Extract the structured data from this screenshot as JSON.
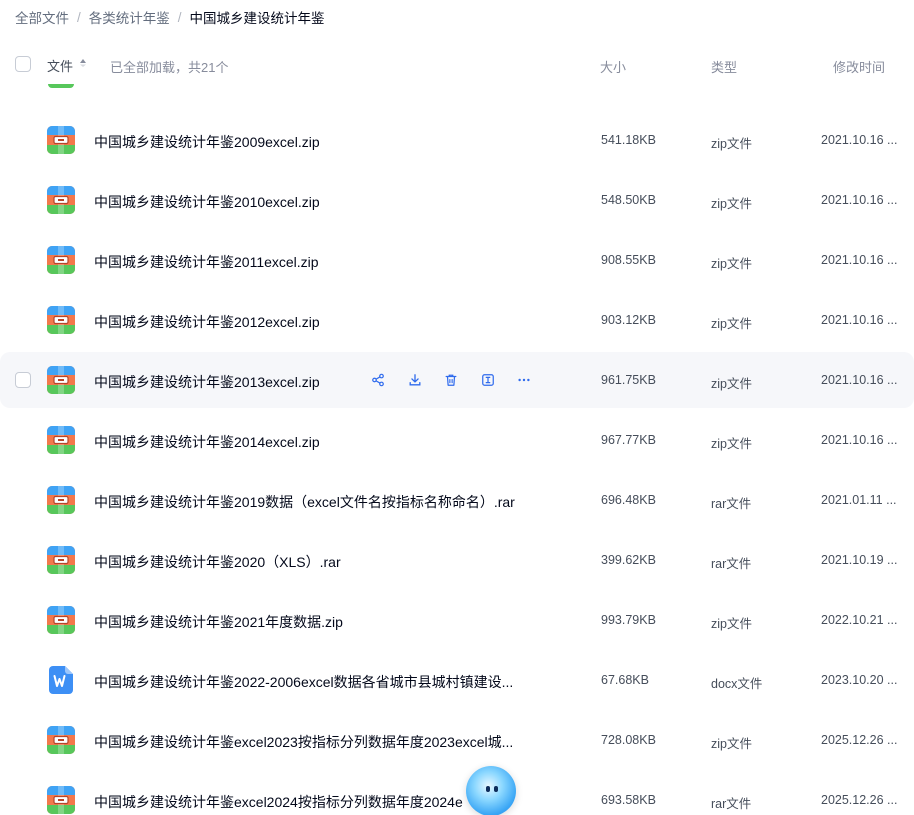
{
  "breadcrumb": {
    "items": [
      "全部文件",
      "各类统计年鉴"
    ],
    "current": "中国城乡建设统计年鉴",
    "separator": "/"
  },
  "header": {
    "name_label": "文件",
    "loaded_text": "已全部加载，共21个",
    "size_label": "大小",
    "type_label": "类型",
    "time_label": "修改时间"
  },
  "colors": {
    "zip_top": "#3fa3f5",
    "zip_middle": "#f2784b",
    "zip_bottom": "#57c75b",
    "doc_blue": "#3d8ff5",
    "hover_bg": "#f6f7fa",
    "action_blue": "#2f6bed"
  },
  "files": [
    {
      "name": "中国城乡建设统计年鉴2009excel.zip",
      "size": "541.18KB",
      "type": "zip文件",
      "time": "2021.10.16 ...",
      "icon": "zip-archive-icon"
    },
    {
      "name": "中国城乡建设统计年鉴2010excel.zip",
      "size": "548.50KB",
      "type": "zip文件",
      "time": "2021.10.16 ...",
      "icon": "zip-archive-icon"
    },
    {
      "name": "中国城乡建设统计年鉴2011excel.zip",
      "size": "908.55KB",
      "type": "zip文件",
      "time": "2021.10.16 ...",
      "icon": "zip-archive-icon"
    },
    {
      "name": "中国城乡建设统计年鉴2012excel.zip",
      "size": "903.12KB",
      "type": "zip文件",
      "time": "2021.10.16 ...",
      "icon": "zip-archive-icon"
    },
    {
      "name": "中国城乡建设统计年鉴2013excel.zip",
      "size": "961.75KB",
      "type": "zip文件",
      "time": "2021.10.16 ...",
      "icon": "zip-archive-icon"
    },
    {
      "name": "中国城乡建设统计年鉴2014excel.zip",
      "size": "967.77KB",
      "type": "zip文件",
      "time": "2021.10.16 ...",
      "icon": "zip-archive-icon"
    },
    {
      "name": "中国城乡建设统计年鉴2019数据（excel文件名按指标名称命名）.rar",
      "size": "696.48KB",
      "type": "rar文件",
      "time": "2021.01.11 ...",
      "icon": "zip-archive-icon"
    },
    {
      "name": "中国城乡建设统计年鉴2020（XLS）.rar",
      "size": "399.62KB",
      "type": "rar文件",
      "time": "2021.10.19 ...",
      "icon": "zip-archive-icon"
    },
    {
      "name": "中国城乡建设统计年鉴2021年度数据.zip",
      "size": "993.79KB",
      "type": "zip文件",
      "time": "2022.10.21 ...",
      "icon": "zip-archive-icon"
    },
    {
      "name": "中国城乡建设统计年鉴2022-2006excel数据各省城市县城村镇建设...",
      "size": "67.68KB",
      "type": "docx文件",
      "time": "2023.10.20 ...",
      "icon": "word-document-icon"
    },
    {
      "name": "中国城乡建设统计年鉴excel2023按指标分列数据年度2023excel城...",
      "size": "728.08KB",
      "type": "zip文件",
      "time": "2025.12.26 ...",
      "icon": "zip-archive-icon"
    },
    {
      "name": "中国城乡建设统计年鉴excel2024按指标分列数据年度2024e",
      "size": "693.58KB",
      "type": "rar文件",
      "time": "2025.12.26 ...",
      "icon": "zip-archive-icon"
    }
  ],
  "hovered_row_index": 4,
  "row_actions": [
    "share-icon",
    "download-icon",
    "delete-icon",
    "rename-icon",
    "more-icon"
  ]
}
